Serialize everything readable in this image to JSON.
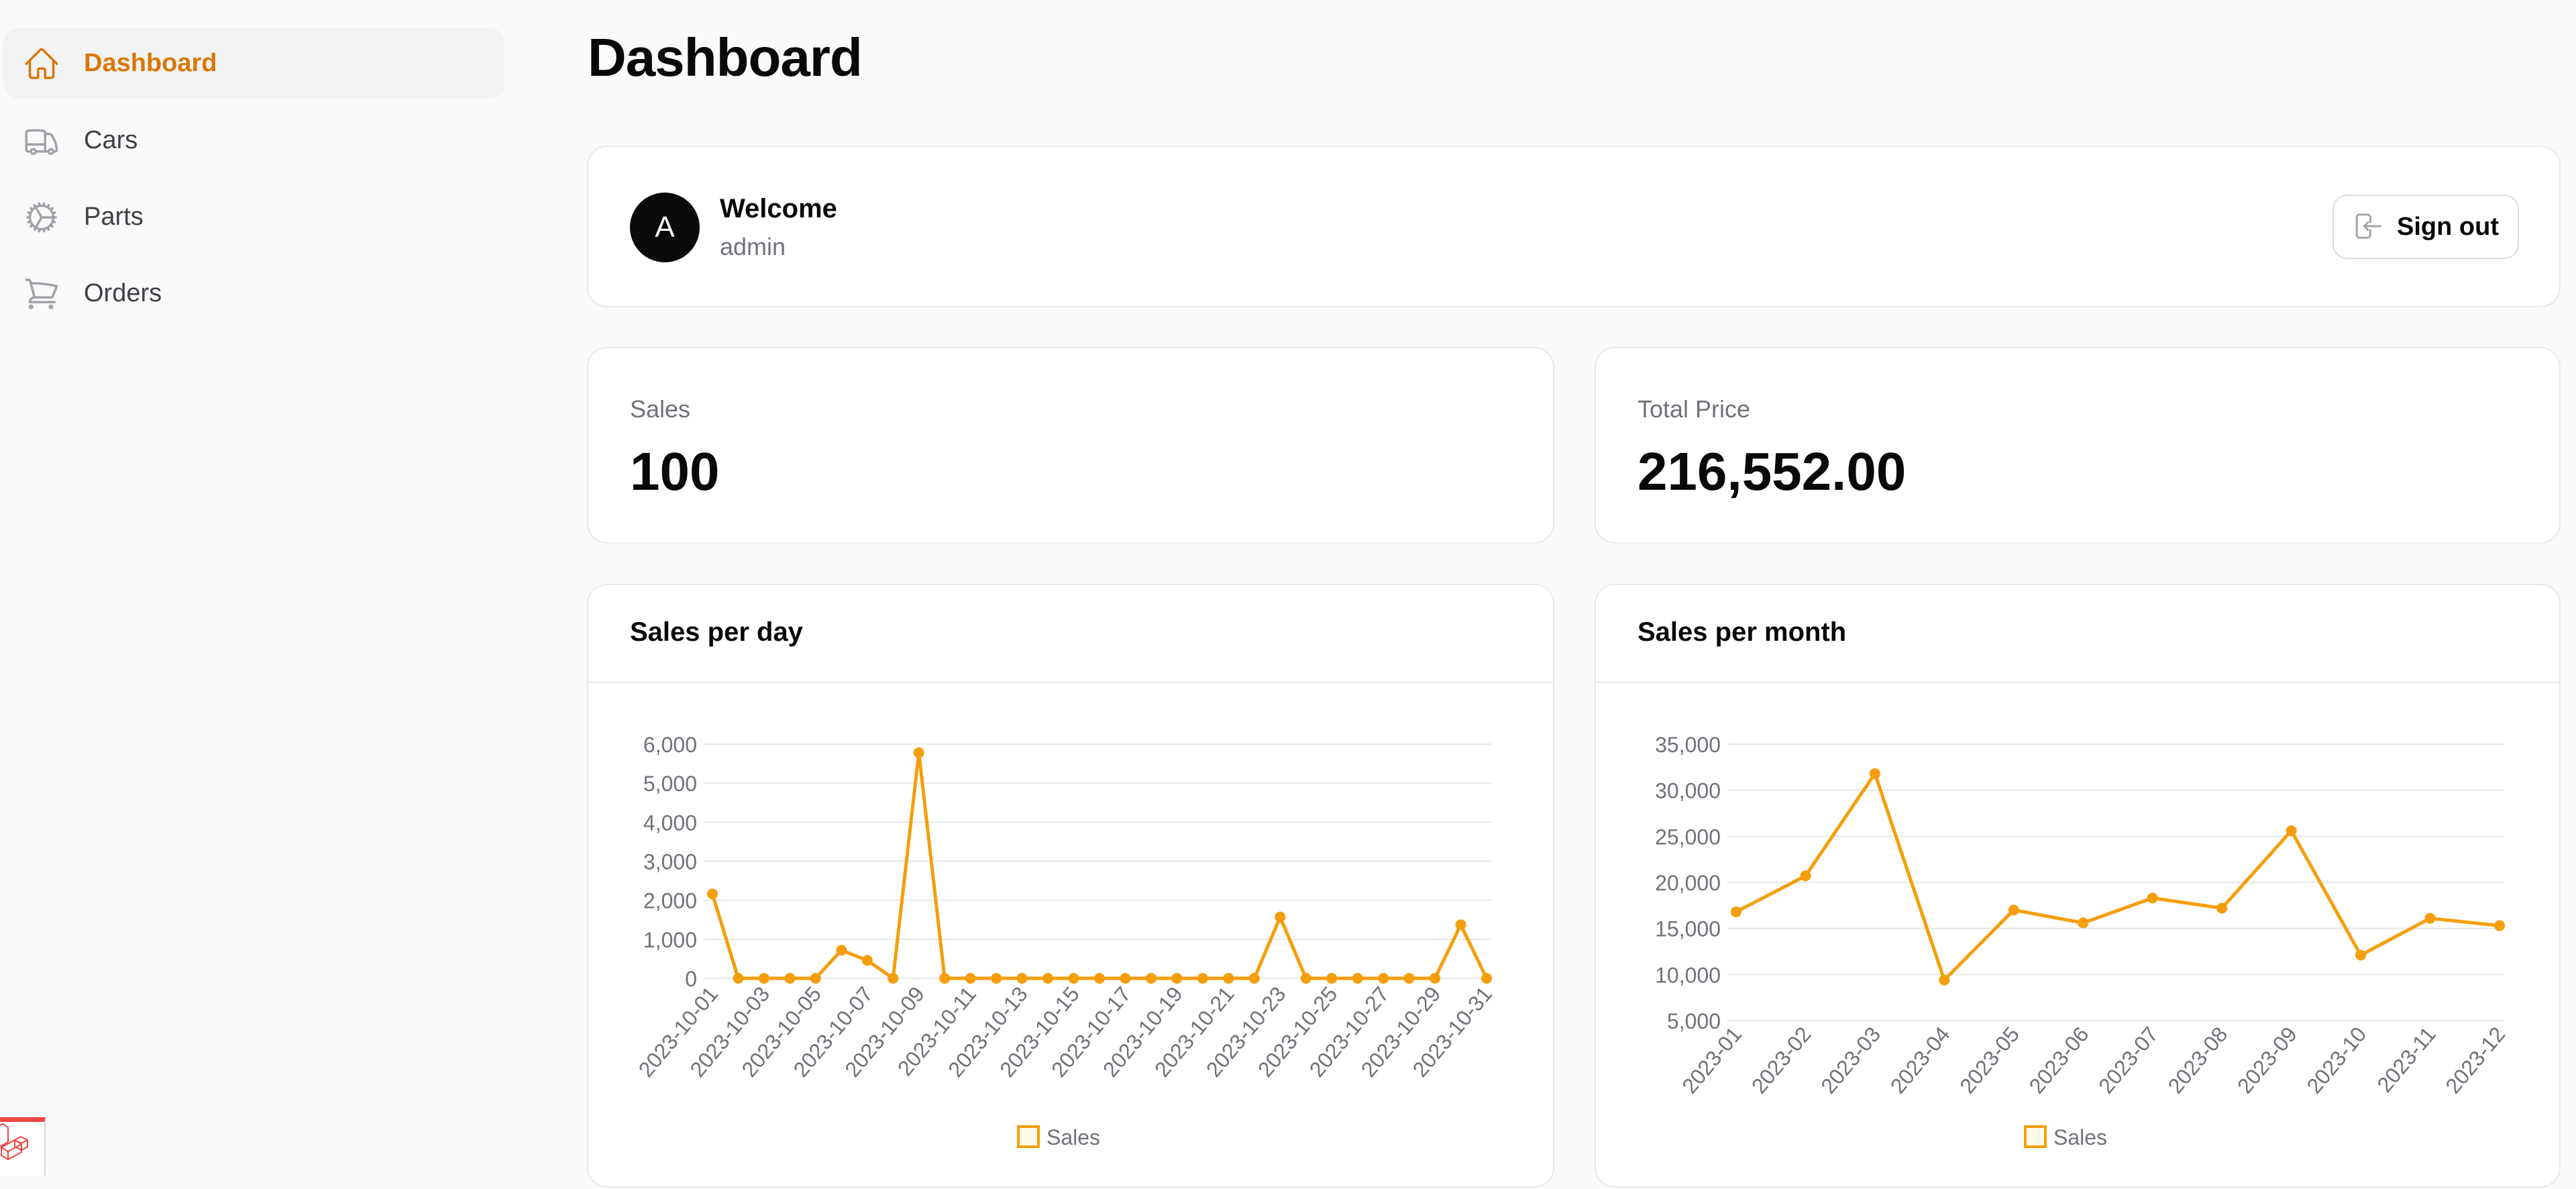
{
  "sidebar": {
    "items": [
      {
        "label": "Dashboard",
        "icon": "home-icon",
        "active": true
      },
      {
        "label": "Cars",
        "icon": "truck-icon",
        "active": false
      },
      {
        "label": "Parts",
        "icon": "cog-icon",
        "active": false
      },
      {
        "label": "Orders",
        "icon": "shopping-cart-icon",
        "active": false
      }
    ]
  },
  "page": {
    "title": "Dashboard"
  },
  "welcome": {
    "avatar_initial": "A",
    "title": "Welcome",
    "username": "admin",
    "signout_label": "Sign out",
    "signout_icon": "arrow-left-on-rectangle-icon"
  },
  "stats": [
    {
      "label": "Sales",
      "value": "100"
    },
    {
      "label": "Total Price",
      "value": "216,552.00"
    }
  ],
  "colors": {
    "accent": "#d97706",
    "series": "#f59e0b",
    "grid": "#e5e7eb",
    "tick": "#71717a"
  },
  "chart_data": [
    {
      "type": "line",
      "title": "Sales per day",
      "xlabel": "",
      "ylabel": "",
      "x": [
        "2023-10-01",
        "2023-10-02",
        "2023-10-03",
        "2023-10-04",
        "2023-10-05",
        "2023-10-06",
        "2023-10-07",
        "2023-10-08",
        "2023-10-09",
        "2023-10-10",
        "2023-10-11",
        "2023-10-12",
        "2023-10-13",
        "2023-10-14",
        "2023-10-15",
        "2023-10-16",
        "2023-10-17",
        "2023-10-18",
        "2023-10-19",
        "2023-10-20",
        "2023-10-21",
        "2023-10-22",
        "2023-10-23",
        "2023-10-24",
        "2023-10-25",
        "2023-10-26",
        "2023-10-27",
        "2023-10-28",
        "2023-10-29",
        "2023-10-30",
        "2023-10-31"
      ],
      "x_tick_labels": [
        "2023-10-01",
        "2023-10-03",
        "2023-10-05",
        "2023-10-07",
        "2023-10-09",
        "2023-10-11",
        "2023-10-13",
        "2023-10-15",
        "2023-10-17",
        "2023-10-19",
        "2023-10-21",
        "2023-10-23",
        "2023-10-25",
        "2023-10-27",
        "2023-10-29",
        "2023-10-31"
      ],
      "series": [
        {
          "name": "Sales",
          "values": [
            2160,
            0,
            0,
            0,
            0,
            720,
            460,
            0,
            5780,
            0,
            0,
            0,
            0,
            0,
            0,
            0,
            0,
            0,
            0,
            0,
            0,
            0,
            1570,
            0,
            0,
            0,
            0,
            0,
            0,
            1370,
            0
          ]
        }
      ],
      "ylim": [
        0,
        6000
      ],
      "y_ticks": [
        0,
        1000,
        2000,
        3000,
        4000,
        5000,
        6000
      ],
      "y_tick_labels": [
        "0",
        "1,000",
        "2,000",
        "3,000",
        "4,000",
        "5,000",
        "6,000"
      ],
      "grid": true,
      "legend": "bottom"
    },
    {
      "type": "line",
      "title": "Sales per month",
      "xlabel": "",
      "ylabel": "",
      "x": [
        "2023-01",
        "2023-02",
        "2023-03",
        "2023-04",
        "2023-05",
        "2023-06",
        "2023-07",
        "2023-08",
        "2023-09",
        "2023-10",
        "2023-11",
        "2023-12"
      ],
      "x_tick_labels": [
        "2023-01",
        "2023-02",
        "2023-03",
        "2023-04",
        "2023-05",
        "2023-06",
        "2023-07",
        "2023-08",
        "2023-09",
        "2023-10",
        "2023-11",
        "2023-12"
      ],
      "series": [
        {
          "name": "Sales",
          "values": [
            16800,
            20700,
            31800,
            9400,
            17000,
            15600,
            18300,
            17200,
            25600,
            12100,
            16100,
            15300
          ]
        }
      ],
      "ylim": [
        5000,
        35000
      ],
      "y_ticks": [
        5000,
        10000,
        15000,
        20000,
        25000,
        30000,
        35000
      ],
      "y_tick_labels": [
        "5,000",
        "10,000",
        "15,000",
        "20,000",
        "25,000",
        "30,000",
        "35,000"
      ],
      "grid": true,
      "legend": "bottom"
    }
  ]
}
